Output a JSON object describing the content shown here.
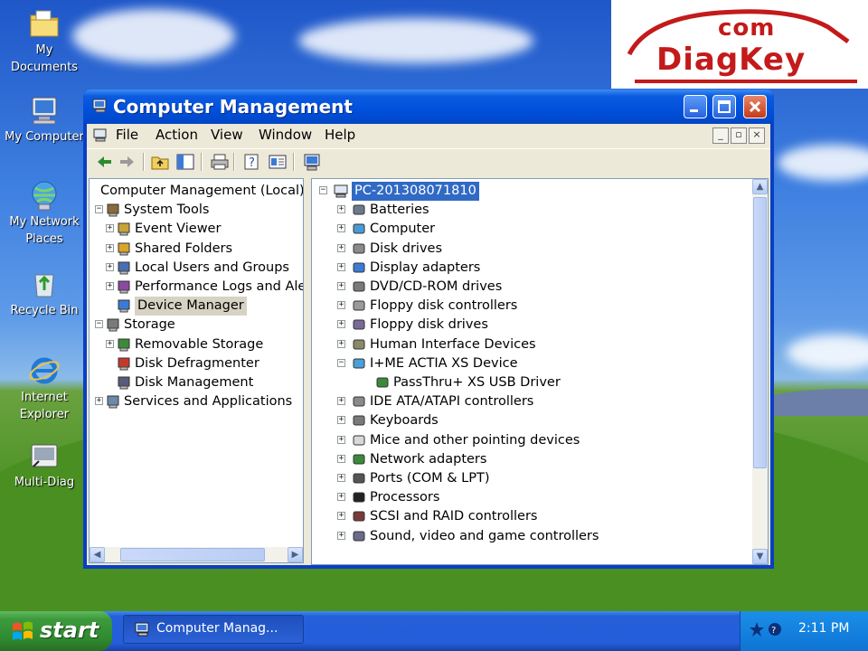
{
  "desktop": {
    "icons": [
      {
        "label": "My Documents",
        "icon": "my-documents-icon"
      },
      {
        "label": "My Computer",
        "icon": "my-computer-icon"
      },
      {
        "label": "My Network Places",
        "icon": "network-places-icon"
      },
      {
        "label": "Recycle Bin",
        "icon": "recycle-bin-icon"
      },
      {
        "label": "Internet Explorer",
        "icon": "internet-explorer-icon"
      },
      {
        "label": "Multi-Diag",
        "icon": "multi-diag-icon"
      }
    ]
  },
  "logo": {
    "com": "com",
    "name": "DiagKey"
  },
  "window": {
    "title": "Computer Management",
    "menu": [
      "File",
      "Action",
      "View",
      "Window",
      "Help"
    ],
    "toolbar_icons": [
      "back-icon",
      "forward-icon",
      "up-folder-icon",
      "show-hide-tree-icon",
      "print-icon",
      "help-icon",
      "properties-icon",
      "scan-hardware-icon"
    ],
    "left_tree": [
      {
        "label": "Computer Management (Local)",
        "icon": "computer-management-icon"
      },
      {
        "label": "System Tools",
        "icon": "system-tools-icon"
      },
      {
        "label": "Event Viewer",
        "icon": "event-viewer-icon"
      },
      {
        "label": "Shared Folders",
        "icon": "shared-folders-icon"
      },
      {
        "label": "Local Users and Groups",
        "icon": "users-icon"
      },
      {
        "label": "Performance Logs and Ale",
        "icon": "performance-icon"
      },
      {
        "label": "Device Manager",
        "icon": "device-manager-icon"
      },
      {
        "label": "Storage",
        "icon": "storage-icon"
      },
      {
        "label": "Removable Storage",
        "icon": "removable-storage-icon"
      },
      {
        "label": "Disk Defragmenter",
        "icon": "defrag-icon"
      },
      {
        "label": "Disk Management",
        "icon": "disk-management-icon"
      },
      {
        "label": "Services and Applications",
        "icon": "services-icon"
      }
    ],
    "device_tree": {
      "root": "PC-201308071810",
      "items": [
        "Batteries",
        "Computer",
        "Disk drives",
        "Display adapters",
        "DVD/CD-ROM drives",
        "Floppy disk controllers",
        "Floppy disk drives",
        "Human Interface Devices",
        "I+ME ACTIA XS Device",
        "PassThru+ XS USB Driver",
        "IDE ATA/ATAPI controllers",
        "Keyboards",
        "Mice and other pointing devices",
        "Network adapters",
        "Ports (COM & LPT)",
        "Processors",
        "SCSI and RAID controllers",
        "Sound, video and game controllers"
      ]
    }
  },
  "taskbar": {
    "start_label": "start",
    "task_label": "Computer Manag...",
    "clock": "2:11 PM"
  },
  "colors": {
    "title_blue": "#0050dc",
    "selection_blue": "#316ac5",
    "start_green": "#3c9a3c",
    "logo_red": "#c41a1a"
  }
}
